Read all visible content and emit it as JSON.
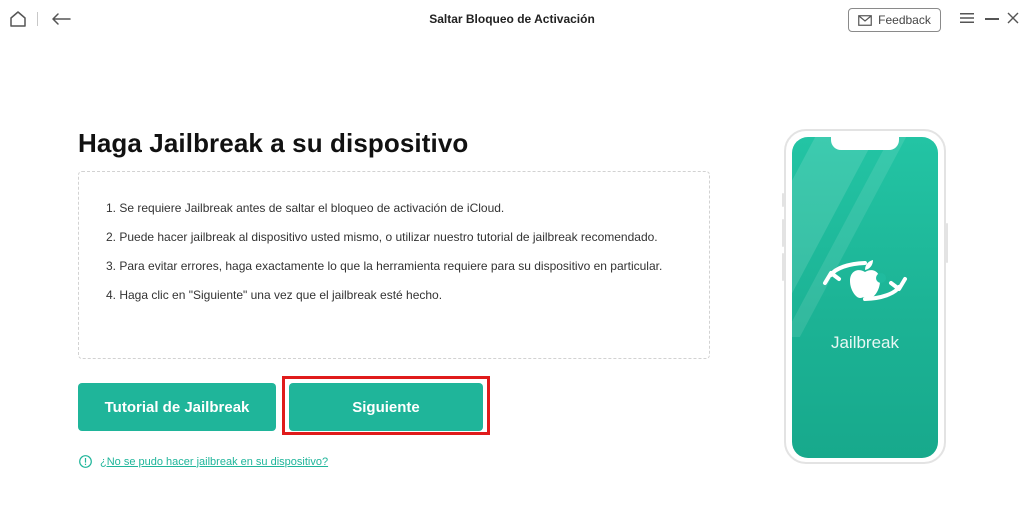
{
  "titlebar": {
    "title": "Saltar Bloqueo de Activación",
    "feedback_label": "Feedback"
  },
  "main": {
    "heading": "Haga Jailbreak a su dispositivo",
    "instructions": [
      "1. Se requiere Jailbreak antes de saltar el bloqueo de activación de iCloud.",
      "2. Puede hacer jailbreak al dispositivo usted mismo, o utilizar nuestro tutorial de jailbreak recomendado.",
      "3. Para evitar errores, haga exactamente lo que la herramienta requiere para su dispositivo en particular.",
      "4. Haga clic en \"Siguiente\" una vez que el jailbreak esté hecho."
    ],
    "tutorial_button": "Tutorial de Jailbreak",
    "next_button": "Siguiente",
    "help_link": "¿No se pudo hacer jailbreak en su dispositivo?"
  },
  "phone": {
    "screen_label": "Jailbreak"
  },
  "colors": {
    "accent": "#1fb59a",
    "highlight": "#e01b1b"
  },
  "icons": [
    "home-icon",
    "back-arrow-icon",
    "mail-icon",
    "menu-icon",
    "minimize-icon",
    "close-icon",
    "info-icon",
    "apple-jailbreak-icon"
  ]
}
